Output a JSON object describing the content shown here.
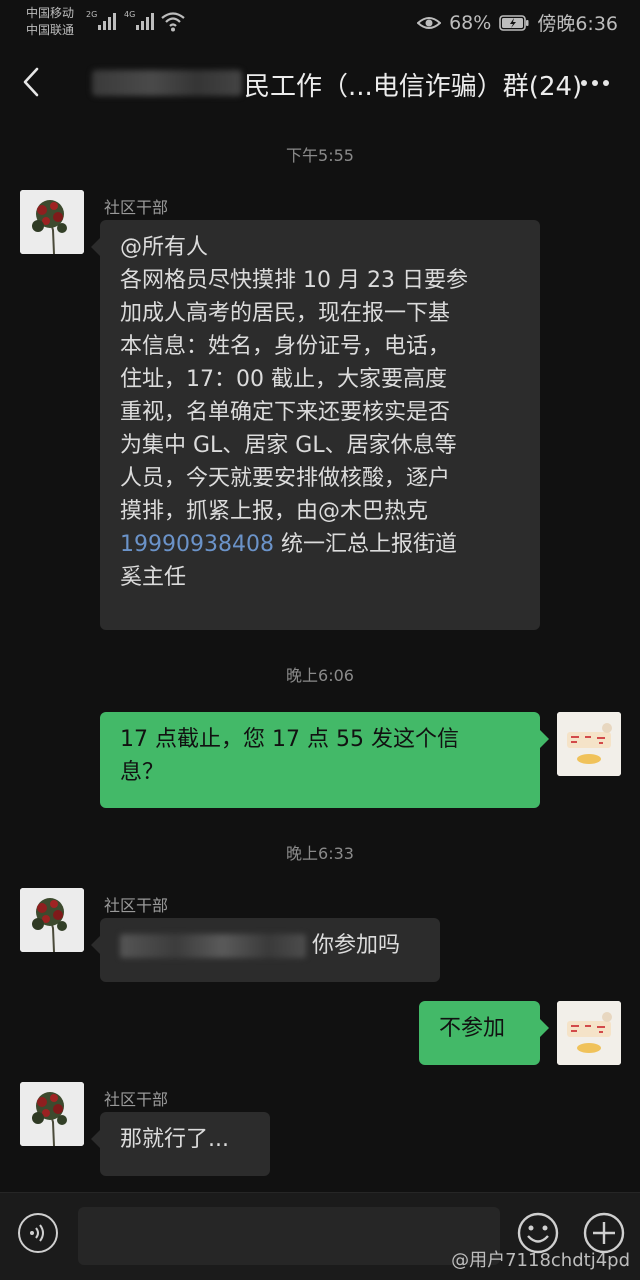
{
  "status_bar": {
    "carrier_1": "中国移动",
    "carrier_2": "中国联通",
    "network_1": "2G",
    "network_2": "4G",
    "battery_percent": "68%",
    "time": "傍晚6:36"
  },
  "header": {
    "title": "民工作（...电信诈骗）群(24)",
    "back_icon": "chevron-left-icon",
    "more_icon": "more-dots-icon"
  },
  "messages": [
    {
      "type": "timestamp",
      "text": "下午5:55"
    },
    {
      "type": "incoming",
      "sender": "社区干部",
      "lines": [
        "@所有人",
        "各网格员尽快摸排 10 月 23 日要参",
        "加成人高考的居民，现在报一下基",
        "本信息：姓名，身份证号，电话，",
        "住址，17：00 截止，大家要高度",
        "重视，名单确定下来还要核实是否",
        "为集中 GL、居家 GL、居家休息等",
        "人员，今天就要安排做核酸，逐户",
        "摸排，抓紧上报，由@木巴热克"
      ],
      "phone": "19990938408",
      "after_phone": " 统一汇总上报街道",
      "last_line": "奚主任"
    },
    {
      "type": "timestamp",
      "text": "晚上6:06"
    },
    {
      "type": "outgoing",
      "lines": [
        "17 点截止，您 17 点 55 发这个信",
        "息？"
      ]
    },
    {
      "type": "timestamp",
      "text": "晚上6:33"
    },
    {
      "type": "incoming",
      "sender": "社区干部",
      "visible_text": "你参加吗"
    },
    {
      "type": "outgoing",
      "text": "不参加"
    },
    {
      "type": "incoming",
      "sender": "社区干部",
      "text": "那就行了..."
    }
  ],
  "input_bar": {
    "voice_icon": "voice-icon",
    "emoji_icon": "emoji-icon",
    "plus_icon": "plus-icon"
  },
  "watermark": "@用户7118chdtj4pd",
  "colors": {
    "background": "#111111",
    "incoming_bubble": "#2c2c2c",
    "outgoing_bubble": "#43b968",
    "link": "#6b93c9"
  }
}
